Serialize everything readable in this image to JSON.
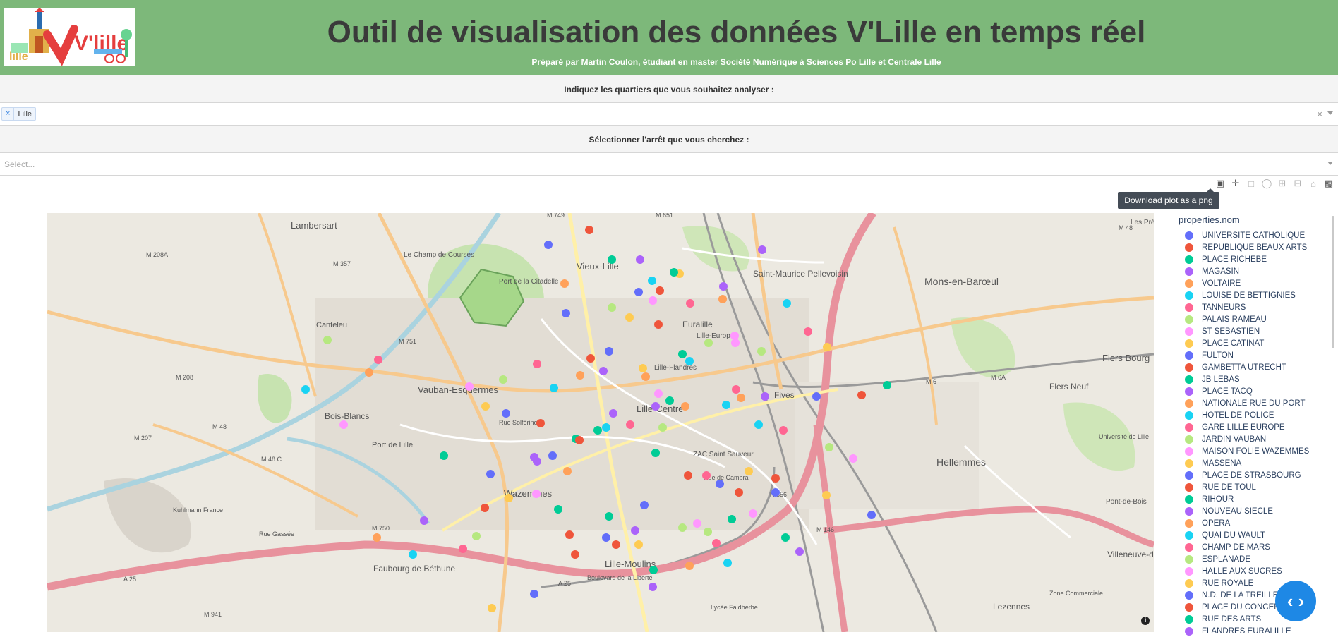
{
  "header": {
    "logo_text": "V'lille",
    "logo_sub": "lille",
    "title": "Outil de visualisation des données V'Lille en temps réel",
    "subtitle": "Préparé par Martin Coulon, étudiant en master Société Numérique à Sciences Po Lille et Centrale Lille",
    "bg_color": "#7db87a"
  },
  "controls": {
    "district_label": "Indiquez les quartiers que vous souhaitez analyser :",
    "district_selected": "Lille",
    "district_remove": "×",
    "district_clear": "×",
    "stop_label": "Sélectionner l'arrêt que vous cherchez :",
    "stop_placeholder": "Select..."
  },
  "modebar": {
    "tooltip": "Download plot as a png",
    "icons": [
      "camera-icon",
      "pan-icon",
      "box-select-icon",
      "lasso-icon",
      "zoom-in-icon",
      "zoom-out-icon",
      "home-icon",
      "plotly-logo-icon"
    ]
  },
  "map": {
    "place_labels": [
      "Lambersart",
      "Canteleu",
      "Le Champ de Courses",
      "Port de la Citadelle",
      "Vieux-Lille",
      "Saint-Maurice Pellevoisin",
      "Mons-en-Barœul",
      "Euralille",
      "Lille-Europe",
      "Lille-Flandres",
      "Vauban-Esquermes",
      "Lille-Centre",
      "Bois-Blancs",
      "Port de Lille",
      "Wazemmes",
      "Faubourg de Béthune",
      "Lille-Moulins",
      "ZAC Saint Sauveur",
      "Hellemmes",
      "Fives",
      "Flers Bourg",
      "Flers Neuf",
      "Université de Lille",
      "Pont-de-Bois",
      "Villeneuve-d'Ascq",
      "Lezennes",
      "Kuhlmann France",
      "Zone Commerciale",
      "Lycée Faidherbe",
      "Les Prés"
    ],
    "road_labels": [
      "M 208A",
      "M 357",
      "M 751",
      "M 749",
      "M 651",
      "M 48",
      "M 208",
      "M 48",
      "M 207",
      "M 48 C",
      "M 750",
      "A 25",
      "A 25",
      "M 941",
      "N 356",
      "M 146",
      "M 6",
      "M 6A",
      "Rue Gassée",
      "Boulevard de la Liberté",
      "Rue Solférino",
      "Rue de Cambrai"
    ],
    "credit": "i"
  },
  "legend": {
    "title": "properties.nom",
    "items": [
      {
        "name": "UNIVERSITE CATHOLIQUE",
        "color": "#636efa"
      },
      {
        "name": "REPUBLIQUE BEAUX ARTS",
        "color": "#ef553b"
      },
      {
        "name": "PLACE RICHEBE",
        "color": "#00cc96"
      },
      {
        "name": "MAGASIN",
        "color": "#ab63fa"
      },
      {
        "name": "VOLTAIRE",
        "color": "#ffa15a"
      },
      {
        "name": "LOUISE DE BETTIGNIES",
        "color": "#19d3f3"
      },
      {
        "name": "TANNEURS",
        "color": "#ff6692"
      },
      {
        "name": "PALAIS RAMEAU",
        "color": "#b6e880"
      },
      {
        "name": "ST SEBASTIEN",
        "color": "#ff97ff"
      },
      {
        "name": "PLACE CATINAT",
        "color": "#fecb52"
      },
      {
        "name": "FULTON",
        "color": "#636efa"
      },
      {
        "name": "GAMBETTA UTRECHT",
        "color": "#ef553b"
      },
      {
        "name": "JB LEBAS",
        "color": "#00cc96"
      },
      {
        "name": "PLACE TACQ",
        "color": "#ab63fa"
      },
      {
        "name": "NATIONALE RUE DU PORT",
        "color": "#ffa15a"
      },
      {
        "name": "HOTEL DE POLICE",
        "color": "#19d3f3"
      },
      {
        "name": "GARE LILLE EUROPE",
        "color": "#ff6692"
      },
      {
        "name": "JARDIN VAUBAN",
        "color": "#b6e880"
      },
      {
        "name": "MAISON FOLIE WAZEMMES",
        "color": "#ff97ff"
      },
      {
        "name": "MASSENA",
        "color": "#fecb52"
      },
      {
        "name": "PLACE DE STRASBOURG",
        "color": "#636efa"
      },
      {
        "name": "RUE DE TOUL",
        "color": "#ef553b"
      },
      {
        "name": "RIHOUR",
        "color": "#00cc96"
      },
      {
        "name": "NOUVEAU SIECLE",
        "color": "#ab63fa"
      },
      {
        "name": "OPERA",
        "color": "#ffa15a"
      },
      {
        "name": "QUAI DU WAULT",
        "color": "#19d3f3"
      },
      {
        "name": "CHAMP DE MARS",
        "color": "#ff6692"
      },
      {
        "name": "ESPLANADE",
        "color": "#b6e880"
      },
      {
        "name": "HALLE AUX SUCRES",
        "color": "#ff97ff"
      },
      {
        "name": "RUE ROYALE",
        "color": "#fecb52"
      },
      {
        "name": "N.D. DE LA TREILLE",
        "color": "#636efa"
      },
      {
        "name": "PLACE DU CONCERT",
        "color": "#ef553b"
      },
      {
        "name": "RUE DES ARTS",
        "color": "#00cc96"
      },
      {
        "name": "FLANDRES EURALILLE",
        "color": "#ab63fa"
      }
    ]
  },
  "code_button": "‹ ›"
}
